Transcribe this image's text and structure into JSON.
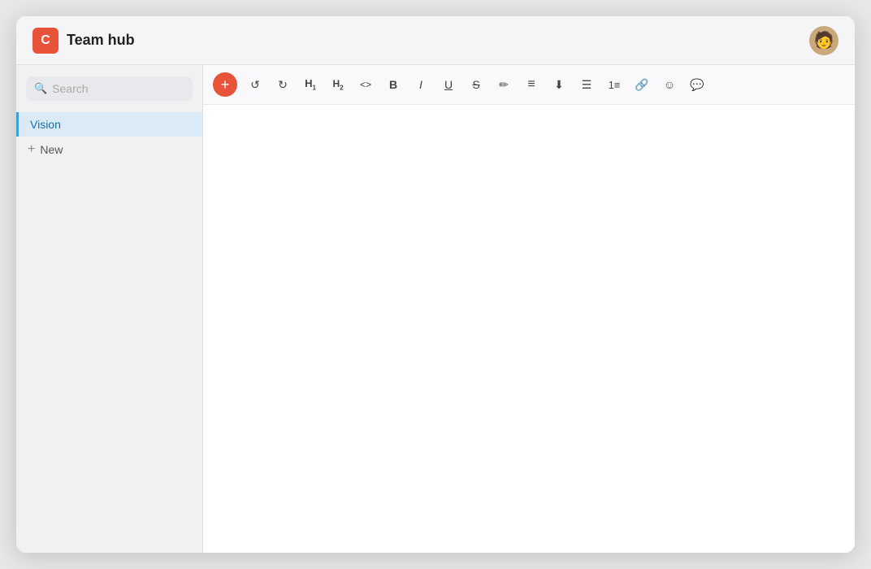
{
  "header": {
    "title": "Team hub",
    "logo_letter": "C",
    "avatar_emoji": "🧑"
  },
  "sidebar": {
    "search_placeholder": "Search",
    "active_item": "Vision",
    "new_item_label": "New"
  },
  "toolbar": {
    "add_label": "+",
    "undo_label": "↺",
    "redo_label": "↻",
    "h1_label": "H1",
    "h2_label": "H2",
    "code_label": "<>",
    "bold_label": "B",
    "italic_label": "I",
    "underline_label": "U",
    "strikethrough_label": "S",
    "highlight_label": "✎",
    "align_label": "≡",
    "indent_label": "⇥",
    "bullet_label": "•≡",
    "numbered_label": "1≡",
    "link_label": "⛓",
    "emoji_label": "☺",
    "comment_label": "💬"
  },
  "editor": {
    "content": ""
  }
}
